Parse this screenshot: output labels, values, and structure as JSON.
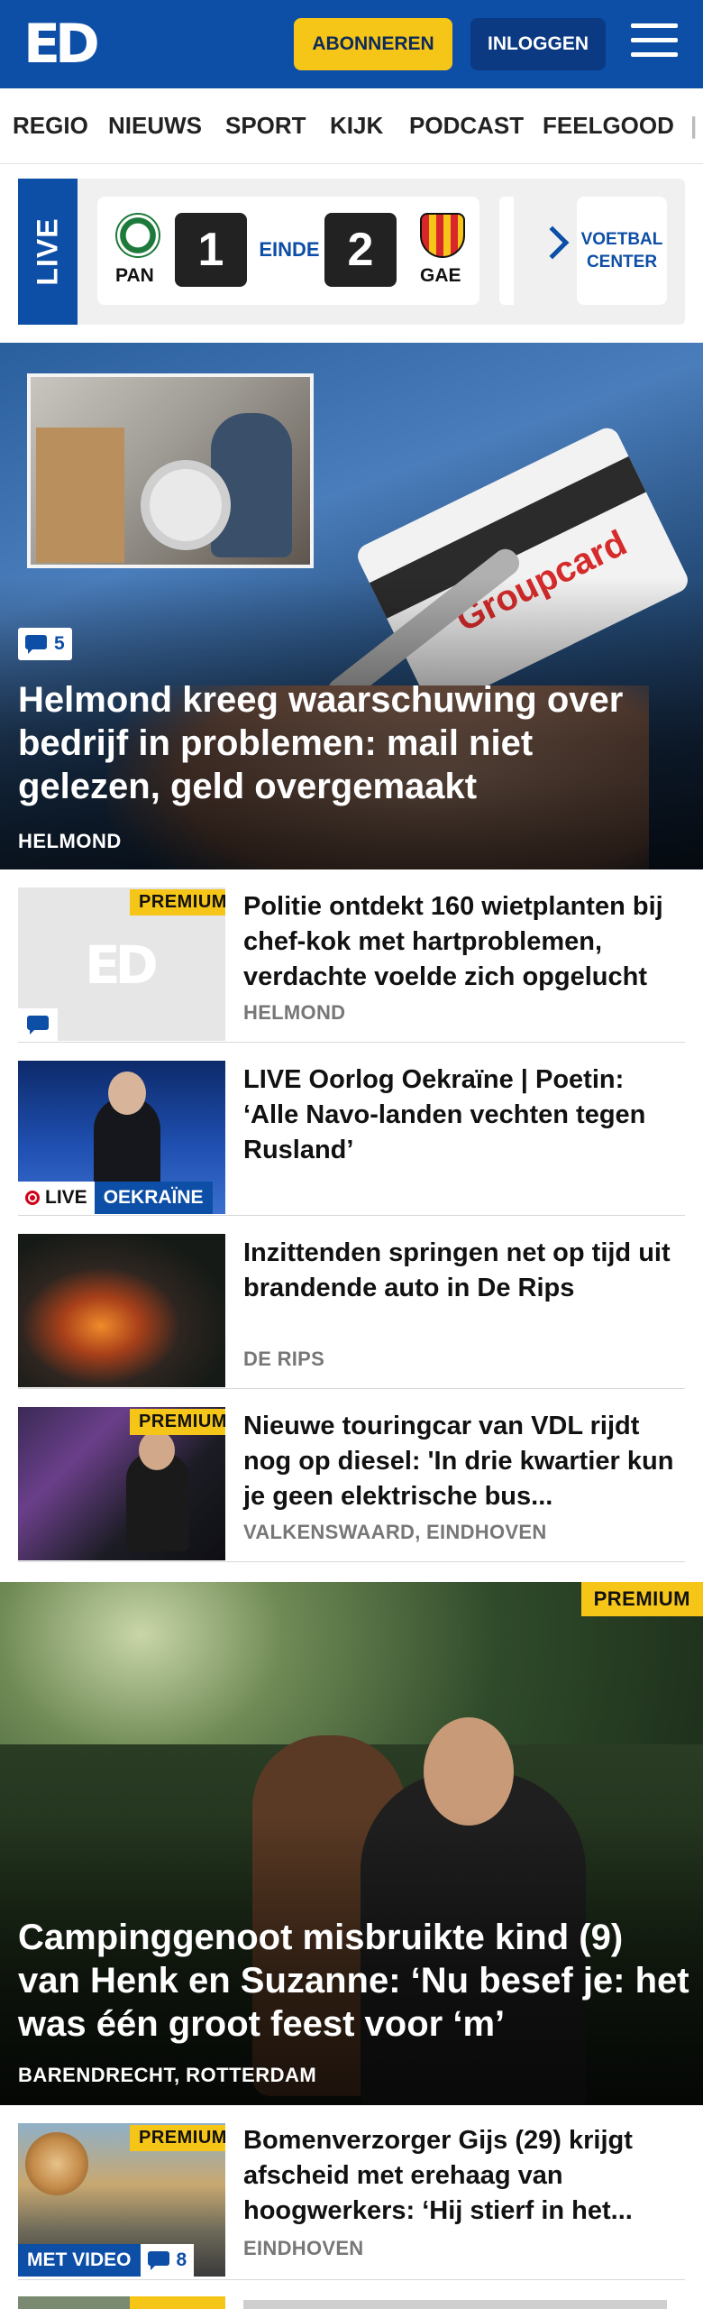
{
  "header": {
    "logo_text": "ED",
    "subscribe_label": "ABONNEREN",
    "login_label": "INLOGGEN",
    "brand_color": "#0d4ea6",
    "accent_color": "#f5c518"
  },
  "nav": {
    "items": [
      "REGIO",
      "NIEUWS",
      "SPORT",
      "KIJK",
      "PODCAST",
      "FEELGOOD"
    ]
  },
  "live": {
    "tag": "LIVE",
    "home_team": "PAN",
    "home_score": "1",
    "status": "EINDE",
    "away_score": "2",
    "away_team": "GAE",
    "center_label_1": "VOETBAL",
    "center_label_2": "CENTER"
  },
  "hero": {
    "comments": "5",
    "title": "Helmond kreeg waarschuwing over bedrijf in problemen: mail niet gelezen, geld overgemaakt",
    "location": "HELMOND",
    "image_text": "Groupcard"
  },
  "articles": [
    {
      "premium": "PREMIUM",
      "title": "Politie ontdekt 160 wietplanten bij chef-kok met hartproblemen, verdachte voelde zich opgelucht",
      "location": "HELMOND",
      "placeholder_logo": "ED"
    },
    {
      "title": "LIVE Oorlog Oekraïne | Poetin: ‘Alle Navo-landen vechten tegen Rusland’",
      "live_label": "LIVE",
      "tag": "OEKRAÏNE"
    },
    {
      "title": "Inzittenden springen net op tijd uit brandende auto in De Rips",
      "location": "DE RIPS"
    },
    {
      "premium": "PREMIUM",
      "title": "Nieuwe touringcar van VDL rijdt nog op diesel: 'In drie kwartier kun je geen elektrische bus...",
      "location": "VALKENSWAARD, EINDHOVEN"
    }
  ],
  "hero2": {
    "premium": "PREMIUM",
    "title": "Campinggenoot misbruikte kind (9) van Henk en Suzanne: ‘Nu besef je: het was één groot feest voor ‘m’",
    "location": "BARENDRECHT, ROTTERDAM"
  },
  "article5": {
    "premium": "PREMIUM",
    "title": "Bomenverzorger Gijs (29) krijgt afscheid met erehaag van hoogwerkers: ‘Hij stierf in het...",
    "location": "EINDHOVEN",
    "video_label": "MET VIDEO",
    "comments": "8"
  }
}
